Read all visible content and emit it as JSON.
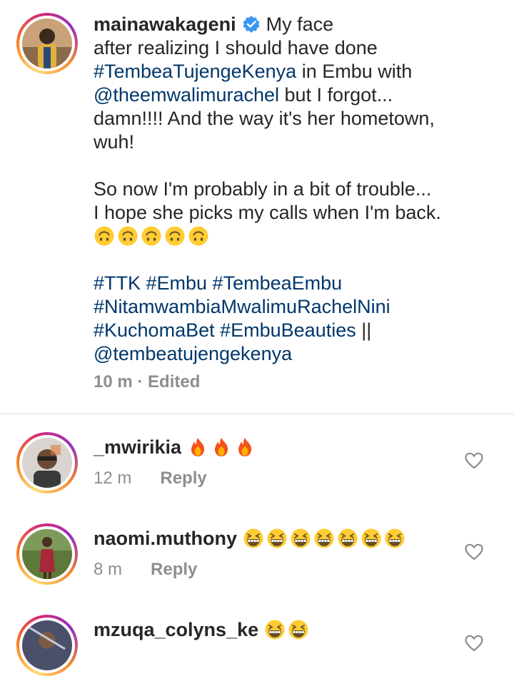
{
  "post": {
    "username": "mainawakageni",
    "caption_line1": "My face",
    "caption_line2": "after realizing I should have done",
    "hashtag1": "#TembeaTujengeKenya",
    "caption_in_embu": " in Embu with",
    "mention1": "@theemwalimurachel",
    "caption_forgot": " but I forgot...",
    "caption_line5": "damn!!!! And the way it's her hometown,",
    "caption_line6": "wuh!",
    "caption_line7": "So now I'm probably in a bit of trouble...",
    "caption_line8": "I hope she picks my calls when I'm back.",
    "hashtags_line1": "#TTK #Embu #TembeaEmbu",
    "hashtags_line2": "#NitamwambiaMwalimuRachelNini",
    "hashtags_line3a": "#KuchomaBet #EmbuBeauties",
    "hashtags_line3b": " ||",
    "mention2": "@tembeatujengekenya",
    "meta": "10 m · Edited",
    "emoji_name": "upside-down-face-emoji",
    "emoji_count": 5
  },
  "comments": [
    {
      "username": "_mwirikia",
      "time": "12 m",
      "reply_label": "Reply",
      "emoji": "fire-emoji",
      "emoji_count": 3
    },
    {
      "username": "naomi.muthony",
      "time": "8 m",
      "reply_label": "Reply",
      "emoji": "grinning-squinting-emoji",
      "emoji_count": 7
    },
    {
      "username": "mzuqa_colyns_ke",
      "emoji": "grinning-squinting-emoji",
      "emoji_count": 2
    }
  ],
  "colors": {
    "link": "#00376b",
    "verified": "#3897f0",
    "muted": "#8e8e8e",
    "text": "#262626",
    "emoji_yellow": "#ffcc33"
  }
}
